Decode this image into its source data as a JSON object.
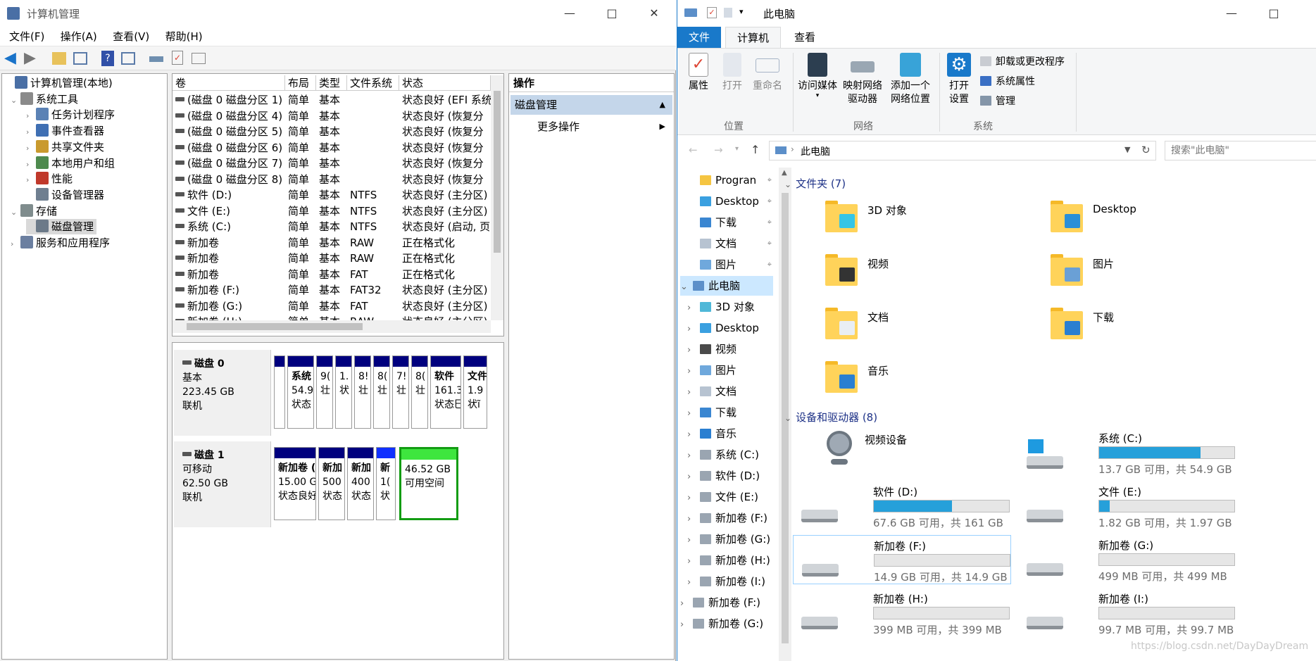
{
  "cm": {
    "title": "计算机管理",
    "menu": [
      "文件(F)",
      "操作(A)",
      "查看(V)",
      "帮助(H)"
    ],
    "tree": [
      {
        "label": "计算机管理(本地)",
        "level": 0,
        "arrow": ""
      },
      {
        "label": "系统工具",
        "level": 1,
        "arrow": "v"
      },
      {
        "label": "任务计划程序",
        "level": 2,
        "arrow": ">"
      },
      {
        "label": "事件查看器",
        "level": 2,
        "arrow": ">"
      },
      {
        "label": "共享文件夹",
        "level": 2,
        "arrow": ">"
      },
      {
        "label": "本地用户和组",
        "level": 2,
        "arrow": ">"
      },
      {
        "label": "性能",
        "level": 2,
        "arrow": ">"
      },
      {
        "label": "设备管理器",
        "level": 2,
        "arrow": ""
      },
      {
        "label": "存储",
        "level": 1,
        "arrow": "v"
      },
      {
        "label": "磁盘管理",
        "level": 2,
        "arrow": "",
        "selected": true
      },
      {
        "label": "服务和应用程序",
        "level": 1,
        "arrow": ">"
      }
    ],
    "vol_headers": [
      "卷",
      "布局",
      "类型",
      "文件系统",
      "状态"
    ],
    "vol_rows": [
      [
        "(磁盘 0 磁盘分区 1)",
        "简单",
        "基本",
        "",
        "状态良好 (EFI 系统"
      ],
      [
        "(磁盘 0 磁盘分区 4)",
        "简单",
        "基本",
        "",
        "状态良好 (恢复分"
      ],
      [
        "(磁盘 0 磁盘分区 5)",
        "简单",
        "基本",
        "",
        "状态良好 (恢复分"
      ],
      [
        "(磁盘 0 磁盘分区 6)",
        "简单",
        "基本",
        "",
        "状态良好 (恢复分"
      ],
      [
        "(磁盘 0 磁盘分区 7)",
        "简单",
        "基本",
        "",
        "状态良好 (恢复分"
      ],
      [
        "(磁盘 0 磁盘分区 8)",
        "简单",
        "基本",
        "",
        "状态良好 (恢复分"
      ],
      [
        "软件 (D:)",
        "简单",
        "基本",
        "NTFS",
        "状态良好 (主分区)"
      ],
      [
        "文件 (E:)",
        "简单",
        "基本",
        "NTFS",
        "状态良好 (主分区)"
      ],
      [
        "系统 (C:)",
        "简单",
        "基本",
        "NTFS",
        "状态良好 (启动, 页"
      ],
      [
        "新加卷",
        "简单",
        "基本",
        "RAW",
        "正在格式化"
      ],
      [
        "新加卷",
        "简单",
        "基本",
        "RAW",
        "正在格式化"
      ],
      [
        "新加卷",
        "简单",
        "基本",
        "FAT",
        "正在格式化"
      ],
      [
        "新加卷 (F:)",
        "简单",
        "基本",
        "FAT32",
        "状态良好 (主分区)"
      ],
      [
        "新加卷 (G:)",
        "简单",
        "基本",
        "FAT",
        "状态良好 (主分区)"
      ],
      [
        "新加卷 (H:)",
        "简单",
        "基本",
        "RAW",
        "状态良好 (主分区)"
      ]
    ],
    "disk0": {
      "name": "磁盘 0",
      "type": "基本",
      "size": "223.45 GB",
      "status": "联机",
      "parts": [
        {
          "l1": "",
          "l2": "",
          "l3": ""
        },
        {
          "l1": "系统",
          "l2": "54.9",
          "l3": "状态"
        },
        {
          "l1": "",
          "l2": "9(",
          "l3": "壮"
        },
        {
          "l1": "",
          "l2": "1.",
          "l3": "状"
        },
        {
          "l1": "",
          "l2": "8!",
          "l3": "壮"
        },
        {
          "l1": "",
          "l2": "8(",
          "l3": "壮"
        },
        {
          "l1": "",
          "l2": "7!",
          "l3": "壮"
        },
        {
          "l1": "",
          "l2": "8(",
          "l3": "壮"
        },
        {
          "l1": "软件",
          "l2": "161.3",
          "l3": "状态巳"
        },
        {
          "l1": "文件",
          "l2": "1.9",
          "l3": "状ĩ"
        }
      ]
    },
    "disk1": {
      "name": "磁盘 1",
      "type": "可移动",
      "size": "62.50 GB",
      "status": "联机",
      "parts": [
        {
          "l1": "新加卷 (",
          "l2": "15.00 G",
          "l3": "状态良好"
        },
        {
          "l1": "新加",
          "l2": "500",
          "l3": "状态"
        },
        {
          "l1": "新加",
          "l2": "400",
          "l3": "状态"
        },
        {
          "l1": "新",
          "l2": "1(",
          "l3": "状"
        },
        {
          "l1": "",
          "l2": "46.52 GB",
          "l3": "可用空间"
        }
      ]
    },
    "actions_title": "操作",
    "actions_section": "磁盘管理",
    "actions_more": "更多操作"
  },
  "ex": {
    "title": "此电脑",
    "tabs": [
      "文件",
      "计算机",
      "查看"
    ],
    "ribbon": {
      "props": "属性",
      "open": "打开",
      "rename": "重命名",
      "media_1": "访问媒体",
      "map_1": "映射网络",
      "map_2": "驱动器",
      "addnet_1": "添加一个",
      "addnet_2": "网络位置",
      "settings_1": "打开",
      "settings_2": "设置",
      "uninstall": "卸载或更改程序",
      "sysprops": "系统属性",
      "manage": "管理",
      "g_location": "位置",
      "g_network": "网络",
      "g_system": "系统"
    },
    "address": "此电脑",
    "search_placeholder": "搜索\"此电脑\"",
    "nav": [
      {
        "label": "Progran",
        "pin": true,
        "indent": 1,
        "arrow": ""
      },
      {
        "label": "Desktop",
        "pin": true,
        "indent": 1,
        "arrow": ""
      },
      {
        "label": "下载",
        "pin": true,
        "indent": 1,
        "arrow": ""
      },
      {
        "label": "文档",
        "pin": true,
        "indent": 1,
        "arrow": ""
      },
      {
        "label": "图片",
        "pin": true,
        "indent": 1,
        "arrow": ""
      },
      {
        "label": "此电脑",
        "pin": false,
        "indent": 0,
        "arrow": "v",
        "selected": true
      },
      {
        "label": "3D 对象",
        "pin": false,
        "indent": 1,
        "arrow": ">"
      },
      {
        "label": "Desktop",
        "pin": false,
        "indent": 1,
        "arrow": ">"
      },
      {
        "label": "视频",
        "pin": false,
        "indent": 1,
        "arrow": ">"
      },
      {
        "label": "图片",
        "pin": false,
        "indent": 1,
        "arrow": ">"
      },
      {
        "label": "文档",
        "pin": false,
        "indent": 1,
        "arrow": ">"
      },
      {
        "label": "下载",
        "pin": false,
        "indent": 1,
        "arrow": ">"
      },
      {
        "label": "音乐",
        "pin": false,
        "indent": 1,
        "arrow": ">"
      },
      {
        "label": "系统 (C:)",
        "pin": false,
        "indent": 1,
        "arrow": ">"
      },
      {
        "label": "软件 (D:)",
        "pin": false,
        "indent": 1,
        "arrow": ">"
      },
      {
        "label": "文件 (E:)",
        "pin": false,
        "indent": 1,
        "arrow": ">"
      },
      {
        "label": "新加卷 (F:)",
        "pin": false,
        "indent": 1,
        "arrow": ">"
      },
      {
        "label": "新加卷 (G:)",
        "pin": false,
        "indent": 1,
        "arrow": ">"
      },
      {
        "label": "新加卷 (H:)",
        "pin": false,
        "indent": 1,
        "arrow": ">"
      },
      {
        "label": "新加卷 (I:)",
        "pin": false,
        "indent": 1,
        "arrow": ">"
      },
      {
        "label": "新加卷 (F:)",
        "pin": false,
        "indent": 0,
        "arrow": ">"
      },
      {
        "label": "新加卷 (G:)",
        "pin": false,
        "indent": 0,
        "arrow": ">"
      }
    ],
    "folders_header": "文件夹 (7)",
    "folders": [
      "3D 对象",
      "Desktop",
      "视频",
      "图片",
      "文档",
      "下载",
      "音乐"
    ],
    "devices_header": "设备和驱动器 (8)",
    "webcam": "视频设备",
    "drives": [
      {
        "name": "系统 (C:)",
        "detail": "13.7 GB 可用，共 54.9 GB",
        "used": 0.75
      },
      {
        "name": "软件 (D:)",
        "detail": "67.6 GB 可用，共 161 GB",
        "used": 0.58
      },
      {
        "name": "文件 (E:)",
        "detail": "1.82 GB 可用，共 1.97 GB",
        "used": 0.08
      },
      {
        "name": "新加卷 (F:)",
        "detail": "14.9 GB 可用，共 14.9 GB",
        "used": 0.0
      },
      {
        "name": "新加卷 (G:)",
        "detail": "499 MB 可用，共 499 MB",
        "used": 0.0
      },
      {
        "name": "新加卷 (H:)",
        "detail": "399 MB 可用，共 399 MB",
        "used": 0.0
      },
      {
        "name": "新加卷 (I:)",
        "detail": "99.7 MB 可用，共 99.7 MB",
        "used": 0.0
      }
    ]
  },
  "watermark": "https://blog.csdn.net/DayDayDream"
}
